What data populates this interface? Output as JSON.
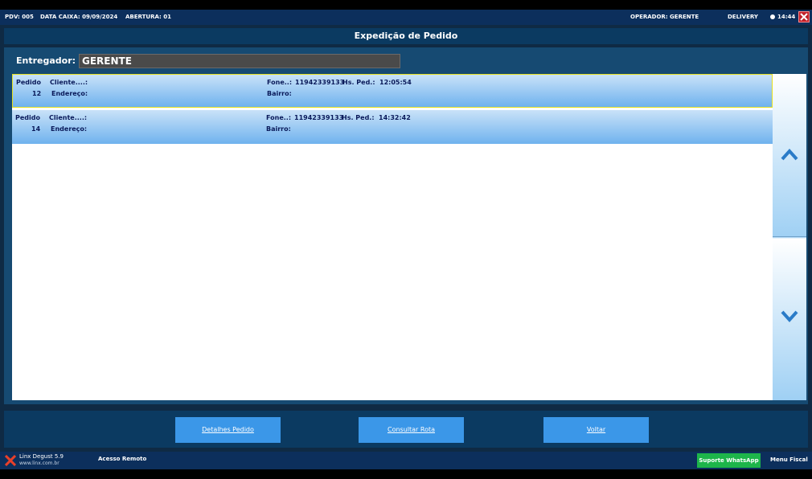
{
  "status": {
    "pdv": "PDV: 005",
    "data_caixa": "DATA CAIXA: 09/09/2024",
    "abertura": "ABERTURA: 01",
    "operador": "OPERADOR:  GERENTE",
    "mode": "DELIVERY",
    "time": "14:44"
  },
  "window_title": "Expedição de Pedido",
  "entregador": {
    "label": "Entregador:",
    "value": "GERENTE"
  },
  "orders": [
    {
      "pedido_label": "Pedido",
      "numero": "12",
      "cliente_label": "Cliente....:",
      "endereco_label": "Endereço:",
      "fone_label": "Fone..:",
      "fone": "11942339133",
      "hs_label": "Hs. Ped.:",
      "hora": "12:05:54",
      "bairro_label": "Bairro:"
    },
    {
      "pedido_label": "Pedido",
      "numero": "14",
      "cliente_label": "Cliente....:",
      "endereco_label": "Endereço:",
      "fone_label": "Fone..:",
      "fone": "11942339133",
      "hs_label": "Hs. Ped.:",
      "hora": "14:32:42",
      "bairro_label": "Bairro:"
    }
  ],
  "buttons": {
    "detalhes": "Detalhes Pedido",
    "consultar": "Consultar Rota",
    "voltar": "Voltar"
  },
  "footer": {
    "brand": "Linx Degust 5.9",
    "site": "www.linx.com.br",
    "remote": "Acesso Remoto",
    "whatsapp": "Suporte WhatsApp",
    "menu_fiscal": "Menu Fiscal"
  },
  "icons": {
    "close": "close-icon",
    "clock": "clock-icon",
    "scroll_up": "chevron-up-icon",
    "scroll_down": "chevron-down-icon",
    "logo": "linx-logo-icon"
  },
  "colors": {
    "background": "#0f2a44",
    "row_highlight": "#6fb2ee",
    "button": "#3b97e8",
    "whatsapp": "#1db54a",
    "close": "#c0202a"
  }
}
